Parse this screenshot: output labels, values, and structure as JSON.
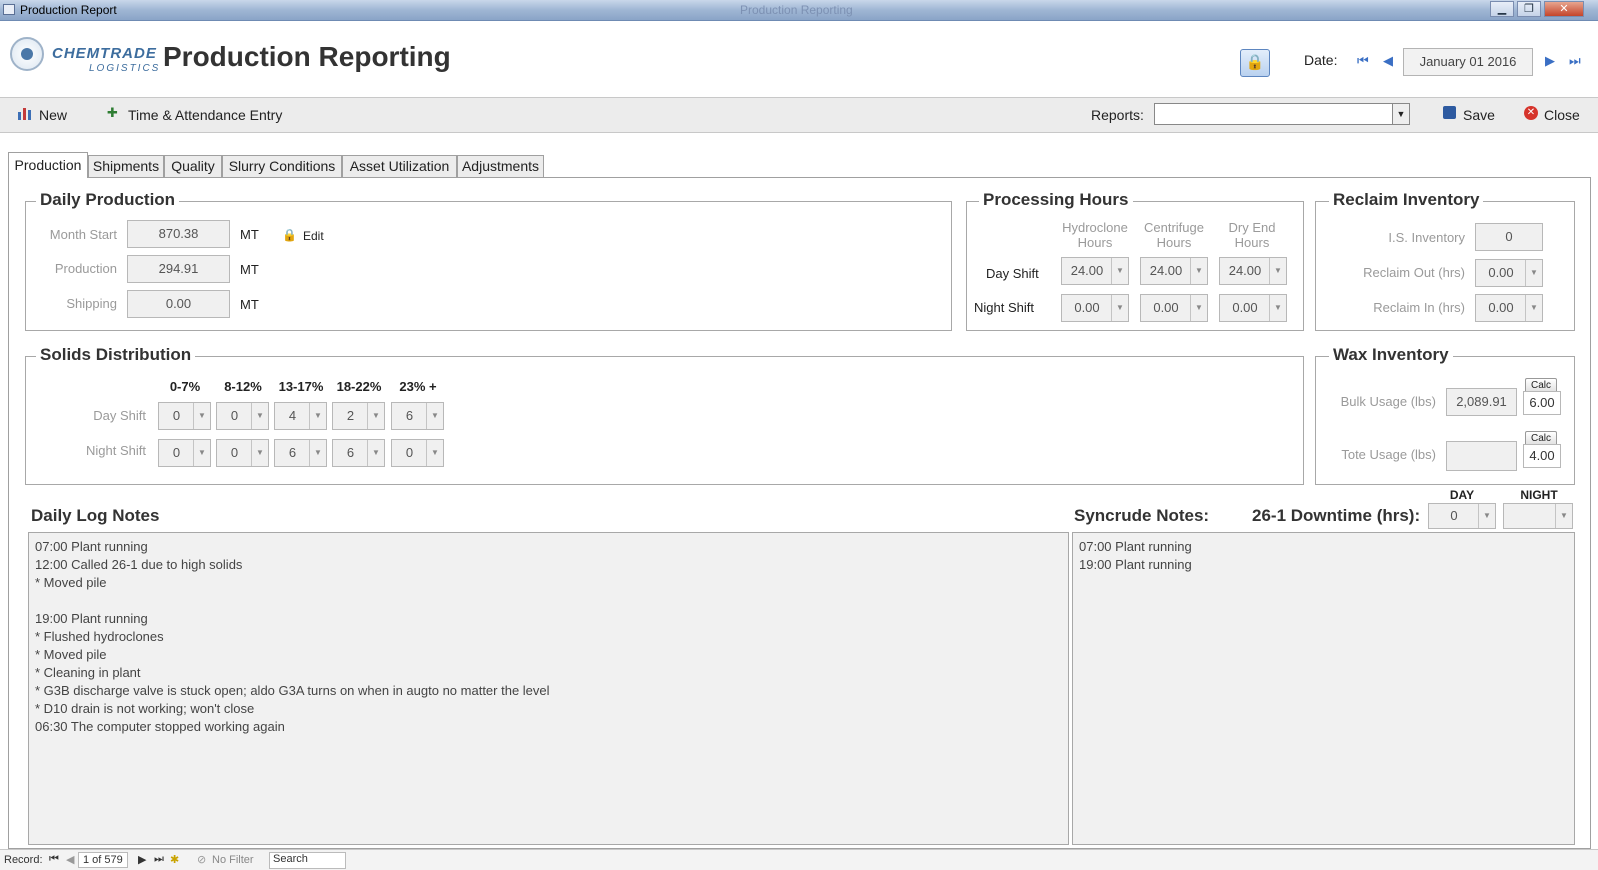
{
  "window": {
    "title": "Production Report",
    "center_title": "Production Reporting",
    "min": "▁",
    "restore": "❐",
    "close": "✕"
  },
  "header": {
    "logo_line1": "CHEMTRADE",
    "logo_line2": "LOGISTICS",
    "title": "Production Reporting",
    "date_label": "Date:",
    "date_value": "January 01 2016"
  },
  "toolbar": {
    "new_label": "New",
    "time_attendance_label": "Time & Attendance Entry",
    "reports_label": "Reports:",
    "reports_value": "",
    "save_label": "Save",
    "close_label": "Close"
  },
  "tabs": [
    "Production",
    "Shipments",
    "Quality",
    "Slurry Conditions",
    "Asset Utilization",
    "Adjustments"
  ],
  "daily_production": {
    "title": "Daily Production",
    "edit_label": "Edit",
    "rows": [
      {
        "label": "Month Start",
        "value": "870.38",
        "unit": "MT"
      },
      {
        "label": "Production",
        "value": "294.91",
        "unit": "MT"
      },
      {
        "label": "Shipping",
        "value": "0.00",
        "unit": "MT"
      }
    ]
  },
  "processing_hours": {
    "title": "Processing Hours",
    "headers": [
      [
        "Hydroclone",
        "Hours"
      ],
      [
        "Centrifuge",
        "Hours"
      ],
      [
        "Dry End",
        "Hours"
      ]
    ],
    "rows": [
      {
        "label": "Day Shift",
        "values": [
          "24.00",
          "24.00",
          "24.00"
        ]
      },
      {
        "label": "Night Shift",
        "values": [
          "0.00",
          "0.00",
          "0.00"
        ]
      }
    ]
  },
  "reclaim_inventory": {
    "title": "Reclaim Inventory",
    "rows": [
      {
        "label": "I.S. Inventory",
        "value": "0"
      },
      {
        "label": "Reclaim Out (hrs)",
        "value": "0.00"
      },
      {
        "label": "Reclaim In (hrs)",
        "value": "0.00"
      }
    ]
  },
  "solids_distribution": {
    "title": "Solids Distribution",
    "headers": [
      "0-7%",
      "8-12%",
      "13-17%",
      "18-22%",
      "23% +"
    ],
    "rows": [
      {
        "label": "Day Shift",
        "values": [
          "0",
          "0",
          "4",
          "2",
          "6"
        ]
      },
      {
        "label": "Night Shift",
        "values": [
          "0",
          "0",
          "6",
          "6",
          "0"
        ]
      }
    ]
  },
  "wax_inventory": {
    "title": "Wax Inventory",
    "calc_label": "Calc",
    "rows": [
      {
        "label": "Bulk Usage (lbs)",
        "value": "2,089.91",
        "calc_value": "6.00"
      },
      {
        "label": "Tote Usage (lbs)",
        "value": "",
        "calc_value": "4.00"
      }
    ]
  },
  "notes": {
    "daily_log_title": "Daily Log Notes",
    "daily_log_text": "07:00 Plant running\n12:00 Called 26-1 due to high solids\n* Moved pile\n\n19:00 Plant running\n* Flushed hydroclones\n* Moved pile\n* Cleaning in plant\n* G3B discharge valve is stuck open; aldo G3A turns on when in augto no matter the level\n* D10 drain is not working; won't close\n06:30 The computer stopped working again",
    "syncrude_title": "Syncrude Notes:",
    "syncrude_text": "07:00 Plant running\n19:00 Plant running",
    "downtime_label": "26-1 Downtime (hrs):",
    "day_label": "DAY",
    "night_label": "NIGHT",
    "day_value": "0",
    "night_value": ""
  },
  "statusbar": {
    "record_label": "Record:",
    "record_value": "1 of 579",
    "filter_label": "No Filter",
    "search_label": "Search"
  }
}
